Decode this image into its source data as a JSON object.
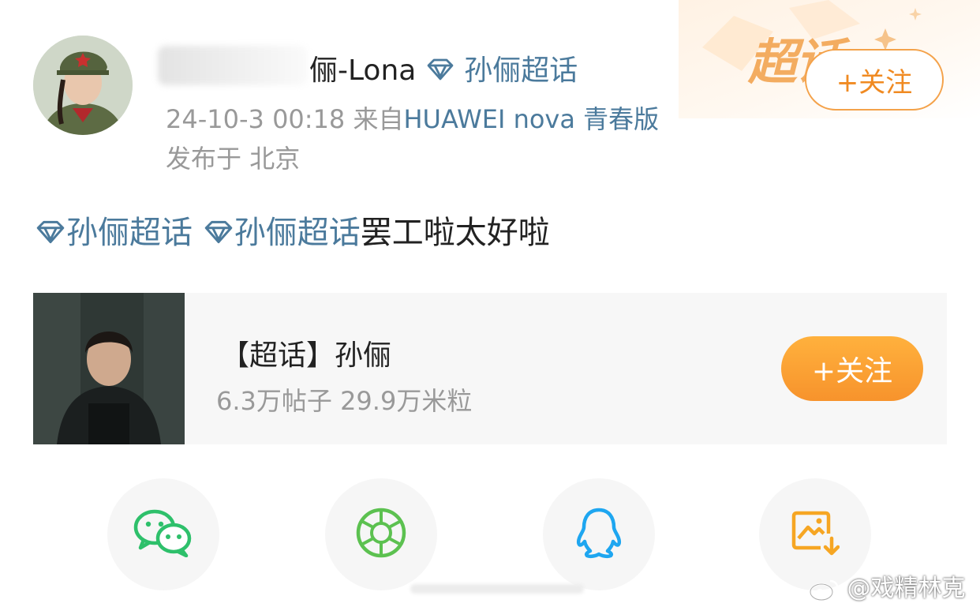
{
  "post": {
    "author_name_visible": "俪-Lona",
    "author_topic": "孙俪超话",
    "timestamp": "24-10-3 00:18",
    "source_prefix": "来自",
    "device": "HUAWEI nova 青春版",
    "location_label": "发布于",
    "location": "北京",
    "follow_label": "+关注",
    "topic_tag_1": "孙俪超话",
    "topic_tag_2": "孙俪超话",
    "body_text": "罢工啦太好啦"
  },
  "decoration": {
    "badge_text": "超话"
  },
  "supertopic_card": {
    "title": "【超话】孙俪",
    "stats": "6.3万帖子 29.9万米粒",
    "follow_label": "+关注"
  },
  "share_bar": {
    "items": [
      "wechat-icon",
      "moments-icon",
      "qq-icon",
      "save-image-icon"
    ]
  },
  "watermark": {
    "text": "@戏精林克"
  },
  "colors": {
    "link": "#4b7a9c",
    "accent_orange": "#f7932c",
    "meta_gray": "#999999",
    "wechat_green": "#2ec06b",
    "moments_green": "#5cc150",
    "qq_blue": "#1ea6f0",
    "save_orange": "#f6a623"
  }
}
